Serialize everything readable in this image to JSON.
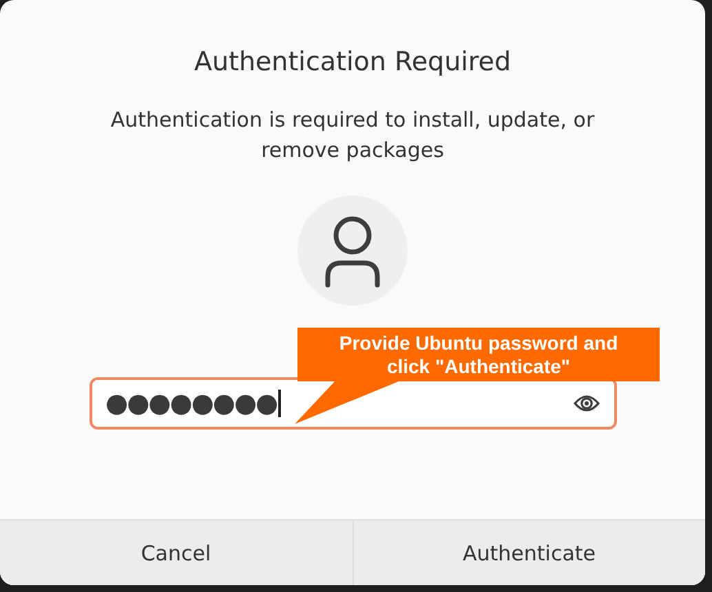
{
  "dialog": {
    "title": "Authentication Required",
    "message": "Authentication is required to install, update, or remove packages"
  },
  "password_field": {
    "value": "●●●●●●●●",
    "focused": true
  },
  "callout": {
    "text": "Provide Ubuntu password and click \"Authenticate\""
  },
  "buttons": [
    "Cancel",
    "Authenticate"
  ]
}
